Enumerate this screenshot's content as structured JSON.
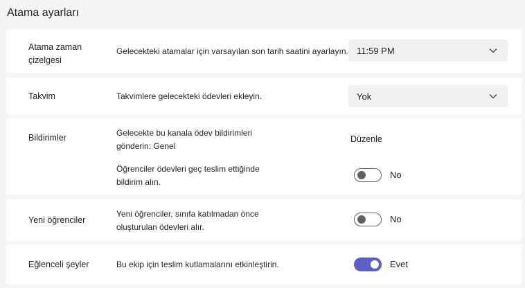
{
  "page": {
    "title": "Atama ayarları"
  },
  "schedule": {
    "label_line1": "Atama zaman",
    "label_line2": "çizelgesi",
    "description": "Gelecekteki atamalar için varsayılan son tarih saatini ayarlayın.",
    "selected": "11:59 PM",
    "icon": "chevron-down-icon"
  },
  "calendar": {
    "label": "Takvim",
    "description": "Takvimlere gelecekteki ödevleri ekleyin.",
    "selected": "Yok",
    "icon": "chevron-down-icon"
  },
  "notifications": {
    "label": "Bildirimler",
    "channel_line1": "Gelecekte bu kanala ödev bildirimleri",
    "channel_line2": "gönderin: Genel",
    "edit_label": "Düzenle",
    "late_line1": "Öğrenciler ödevleri geç teslim ettiğinde",
    "late_line2": "bildirim alın.",
    "late_toggle": {
      "on": false,
      "state_label": "No"
    }
  },
  "new_students": {
    "label": "Yeni öğrenciler",
    "line1": "Yeni öğrenciler, sınıfa katılmadan önce",
    "line2": "oluşturulan ödevleri alır.",
    "toggle": {
      "on": false,
      "state_label": "No"
    }
  },
  "fun_stuff": {
    "label": "Eğlenceli şeyler",
    "description": "Bu ekip için teslim kutlamalarını etkinleştirin.",
    "toggle": {
      "on": true,
      "state_label": "Evet"
    }
  },
  "colors": {
    "accent": "#5b5fc7",
    "toggle_off": "#616161",
    "card": "#ffffff",
    "background": "#f5f5f5"
  }
}
